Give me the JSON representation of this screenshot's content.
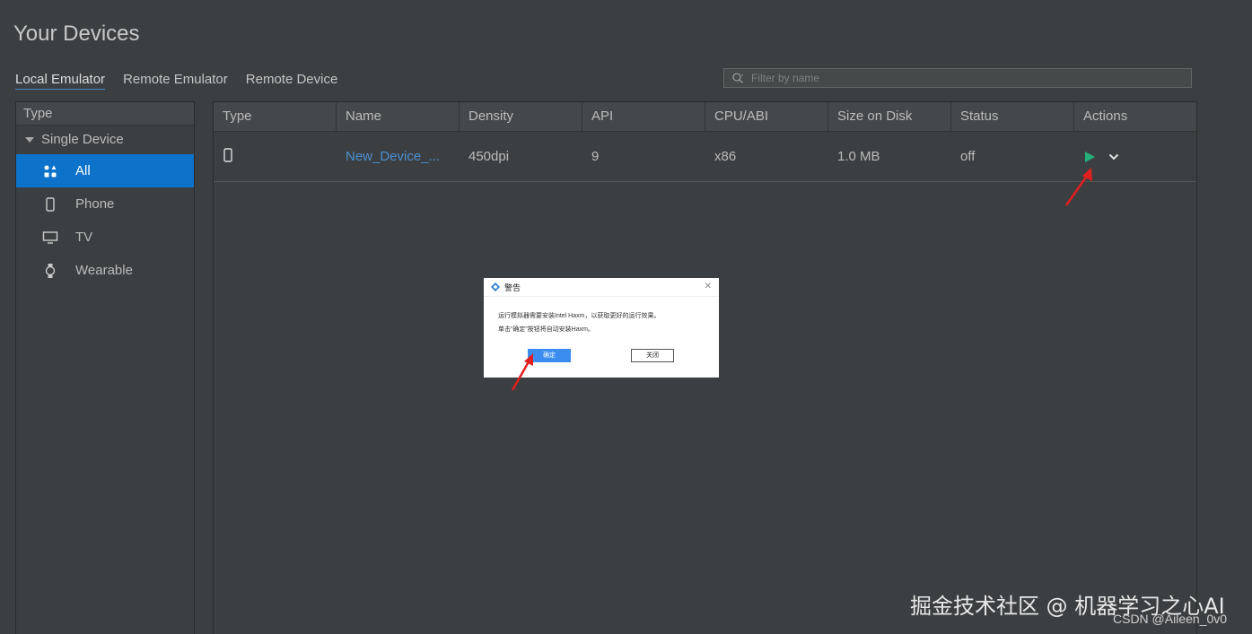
{
  "page": {
    "title": "Your Devices",
    "tabs": [
      {
        "label": "Local Emulator",
        "active": true
      },
      {
        "label": "Remote Emulator",
        "active": false
      },
      {
        "label": "Remote Device",
        "active": false
      }
    ],
    "filter_placeholder": "Filter by name"
  },
  "sidebar": {
    "header": "Type",
    "group": "Single Device",
    "items": [
      {
        "label": "All",
        "icon": "grid-icon",
        "selected": true
      },
      {
        "label": "Phone",
        "icon": "phone-icon",
        "selected": false
      },
      {
        "label": "TV",
        "icon": "tv-icon",
        "selected": false
      },
      {
        "label": "Wearable",
        "icon": "watch-icon",
        "selected": false
      }
    ]
  },
  "table": {
    "columns": [
      "Type",
      "Name",
      "Density",
      "API",
      "CPU/ABI",
      "Size on Disk",
      "Status",
      "Actions"
    ],
    "rows": [
      {
        "type_icon": "phone-icon",
        "name": "New_Device_...",
        "density": "450dpi",
        "api": "9",
        "cpu": "x86",
        "size": "1.0 MB",
        "status": "off"
      }
    ]
  },
  "dialog": {
    "title": "警告",
    "line1": "运行模拟器需要安装Intel Haxm，以获取更好的运行效果。",
    "line2": "单击“确定”按钮将自动安装Haxm。",
    "ok_label": "确定",
    "close_label": "关闭"
  },
  "watermark": {
    "main": "掘金技术社区 @ 机器学习之心AI",
    "sub": "CSDN @Aileen_0v0"
  },
  "colors": {
    "background": "#3c3f41",
    "selection": "#0d72c9",
    "link": "#4b8ed1",
    "play": "#23b07b",
    "arrow": "#e02020"
  }
}
